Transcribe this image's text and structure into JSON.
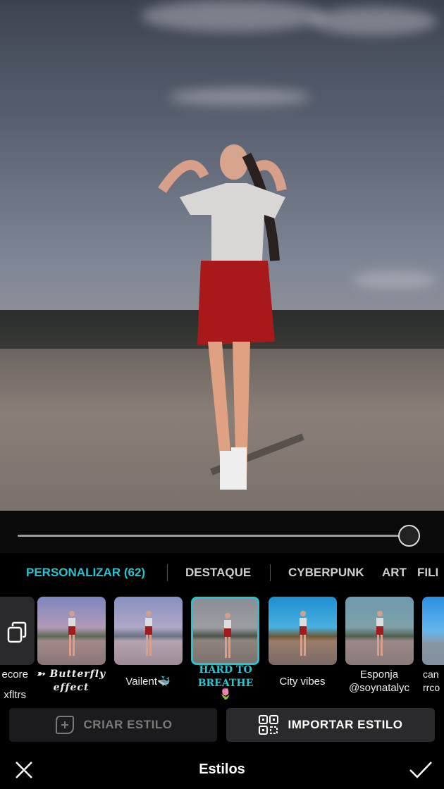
{
  "photo": {
    "description_icon": "photo-preview"
  },
  "slider": {
    "value_percent": 100
  },
  "tabs": [
    {
      "label": "PERSONALIZAR (62)",
      "active": true
    },
    {
      "label": "DESTAQUE"
    },
    {
      "label": "CYBERPUNK"
    },
    {
      "label": "ART"
    },
    {
      "label": "FILI"
    }
  ],
  "styles": [
    {
      "label": "ecore",
      "label2": "xfltrs",
      "icon": "copy-stack-icon"
    },
    {
      "label": "➳ Butterfly effect"
    },
    {
      "label": "Vailent🐳"
    },
    {
      "label": "HARD TO BREATHE",
      "label2": "🌷",
      "selected": true
    },
    {
      "label": "City vibes"
    },
    {
      "label": "Esponja",
      "label2": "@soynatalyc"
    },
    {
      "label": "can",
      "label2": "rrco"
    }
  ],
  "buttons": {
    "create": "CRIAR ESTILO",
    "import": "IMPORTAR ESTILO"
  },
  "footer": {
    "title": "Estilos"
  },
  "colors": {
    "accent": "#27c4cf",
    "background": "#000000"
  }
}
